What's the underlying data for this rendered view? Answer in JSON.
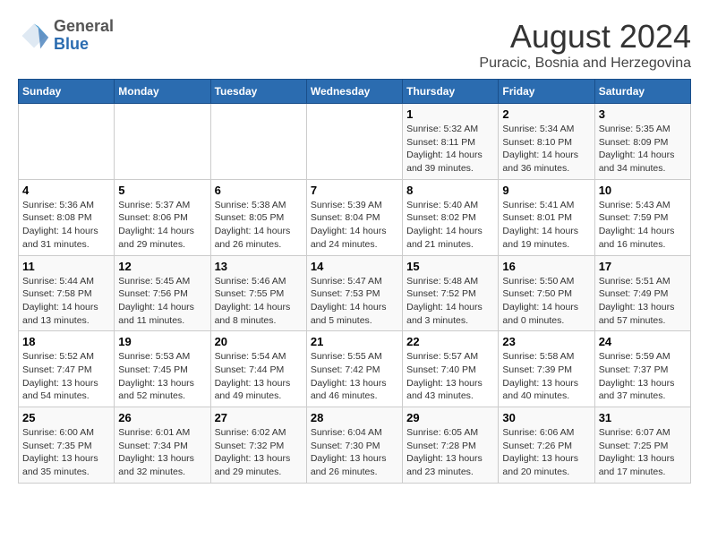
{
  "header": {
    "logo_general": "General",
    "logo_blue": "Blue",
    "month_title": "August 2024",
    "location": "Puracic, Bosnia and Herzegovina"
  },
  "calendar": {
    "days_of_week": [
      "Sunday",
      "Monday",
      "Tuesday",
      "Wednesday",
      "Thursday",
      "Friday",
      "Saturday"
    ],
    "weeks": [
      [
        {
          "day": "",
          "info": ""
        },
        {
          "day": "",
          "info": ""
        },
        {
          "day": "",
          "info": ""
        },
        {
          "day": "",
          "info": ""
        },
        {
          "day": "1",
          "info": "Sunrise: 5:32 AM\nSunset: 8:11 PM\nDaylight: 14 hours\nand 39 minutes."
        },
        {
          "day": "2",
          "info": "Sunrise: 5:34 AM\nSunset: 8:10 PM\nDaylight: 14 hours\nand 36 minutes."
        },
        {
          "day": "3",
          "info": "Sunrise: 5:35 AM\nSunset: 8:09 PM\nDaylight: 14 hours\nand 34 minutes."
        }
      ],
      [
        {
          "day": "4",
          "info": "Sunrise: 5:36 AM\nSunset: 8:08 PM\nDaylight: 14 hours\nand 31 minutes."
        },
        {
          "day": "5",
          "info": "Sunrise: 5:37 AM\nSunset: 8:06 PM\nDaylight: 14 hours\nand 29 minutes."
        },
        {
          "day": "6",
          "info": "Sunrise: 5:38 AM\nSunset: 8:05 PM\nDaylight: 14 hours\nand 26 minutes."
        },
        {
          "day": "7",
          "info": "Sunrise: 5:39 AM\nSunset: 8:04 PM\nDaylight: 14 hours\nand 24 minutes."
        },
        {
          "day": "8",
          "info": "Sunrise: 5:40 AM\nSunset: 8:02 PM\nDaylight: 14 hours\nand 21 minutes."
        },
        {
          "day": "9",
          "info": "Sunrise: 5:41 AM\nSunset: 8:01 PM\nDaylight: 14 hours\nand 19 minutes."
        },
        {
          "day": "10",
          "info": "Sunrise: 5:43 AM\nSunset: 7:59 PM\nDaylight: 14 hours\nand 16 minutes."
        }
      ],
      [
        {
          "day": "11",
          "info": "Sunrise: 5:44 AM\nSunset: 7:58 PM\nDaylight: 14 hours\nand 13 minutes."
        },
        {
          "day": "12",
          "info": "Sunrise: 5:45 AM\nSunset: 7:56 PM\nDaylight: 14 hours\nand 11 minutes."
        },
        {
          "day": "13",
          "info": "Sunrise: 5:46 AM\nSunset: 7:55 PM\nDaylight: 14 hours\nand 8 minutes."
        },
        {
          "day": "14",
          "info": "Sunrise: 5:47 AM\nSunset: 7:53 PM\nDaylight: 14 hours\nand 5 minutes."
        },
        {
          "day": "15",
          "info": "Sunrise: 5:48 AM\nSunset: 7:52 PM\nDaylight: 14 hours\nand 3 minutes."
        },
        {
          "day": "16",
          "info": "Sunrise: 5:50 AM\nSunset: 7:50 PM\nDaylight: 14 hours\nand 0 minutes."
        },
        {
          "day": "17",
          "info": "Sunrise: 5:51 AM\nSunset: 7:49 PM\nDaylight: 13 hours\nand 57 minutes."
        }
      ],
      [
        {
          "day": "18",
          "info": "Sunrise: 5:52 AM\nSunset: 7:47 PM\nDaylight: 13 hours\nand 54 minutes."
        },
        {
          "day": "19",
          "info": "Sunrise: 5:53 AM\nSunset: 7:45 PM\nDaylight: 13 hours\nand 52 minutes."
        },
        {
          "day": "20",
          "info": "Sunrise: 5:54 AM\nSunset: 7:44 PM\nDaylight: 13 hours\nand 49 minutes."
        },
        {
          "day": "21",
          "info": "Sunrise: 5:55 AM\nSunset: 7:42 PM\nDaylight: 13 hours\nand 46 minutes."
        },
        {
          "day": "22",
          "info": "Sunrise: 5:57 AM\nSunset: 7:40 PM\nDaylight: 13 hours\nand 43 minutes."
        },
        {
          "day": "23",
          "info": "Sunrise: 5:58 AM\nSunset: 7:39 PM\nDaylight: 13 hours\nand 40 minutes."
        },
        {
          "day": "24",
          "info": "Sunrise: 5:59 AM\nSunset: 7:37 PM\nDaylight: 13 hours\nand 37 minutes."
        }
      ],
      [
        {
          "day": "25",
          "info": "Sunrise: 6:00 AM\nSunset: 7:35 PM\nDaylight: 13 hours\nand 35 minutes."
        },
        {
          "day": "26",
          "info": "Sunrise: 6:01 AM\nSunset: 7:34 PM\nDaylight: 13 hours\nand 32 minutes."
        },
        {
          "day": "27",
          "info": "Sunrise: 6:02 AM\nSunset: 7:32 PM\nDaylight: 13 hours\nand 29 minutes."
        },
        {
          "day": "28",
          "info": "Sunrise: 6:04 AM\nSunset: 7:30 PM\nDaylight: 13 hours\nand 26 minutes."
        },
        {
          "day": "29",
          "info": "Sunrise: 6:05 AM\nSunset: 7:28 PM\nDaylight: 13 hours\nand 23 minutes."
        },
        {
          "day": "30",
          "info": "Sunrise: 6:06 AM\nSunset: 7:26 PM\nDaylight: 13 hours\nand 20 minutes."
        },
        {
          "day": "31",
          "info": "Sunrise: 6:07 AM\nSunset: 7:25 PM\nDaylight: 13 hours\nand 17 minutes."
        }
      ]
    ]
  }
}
